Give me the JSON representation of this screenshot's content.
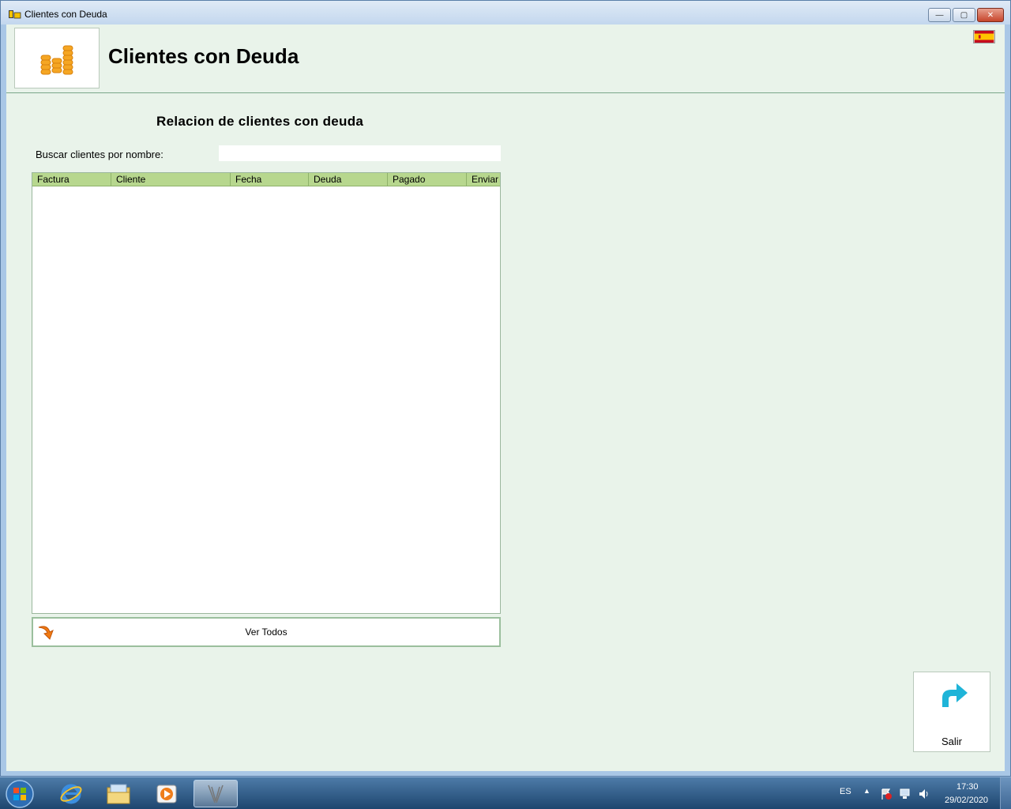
{
  "window": {
    "title": "Clientes con Deuda",
    "buttons": {
      "minimize": "—",
      "maximize": "▢",
      "close": "✕"
    }
  },
  "header": {
    "title": "Clientes con Deuda",
    "logo_icon": "coin-stacks-icon",
    "language_flag": "spain-flag-icon"
  },
  "main": {
    "subtitle": "Relacion de clientes con deuda",
    "search": {
      "label": "Buscar clientes por nombre:",
      "value": "",
      "placeholder": ""
    },
    "grid": {
      "columns": [
        "Factura",
        "Cliente",
        "Fecha",
        "Deuda",
        "Pagado",
        "Enviar"
      ],
      "rows": []
    },
    "ver_todos_label": "Ver Todos"
  },
  "actions": {
    "salir_label": "Salir"
  },
  "taskbar": {
    "language": "ES",
    "time": "17:30",
    "date": "29/02/2020"
  },
  "colors": {
    "background": "#e9f3ea",
    "grid_header": "#b7d78e",
    "accent_arrow": "#1fb4d8",
    "coin": "#f5a623"
  }
}
